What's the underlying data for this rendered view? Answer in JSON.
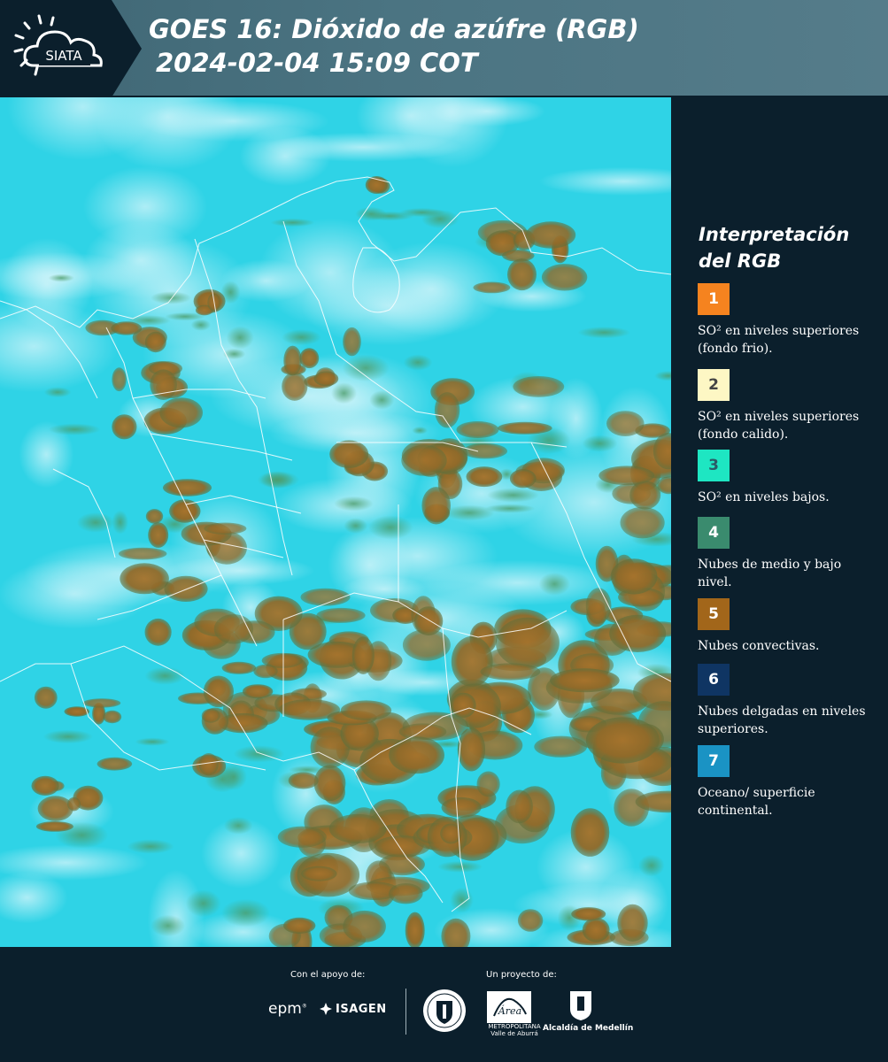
{
  "header": {
    "logo_text": "SIATA",
    "title_line1": "GOES 16: Dióxido de azúfre (RGB)",
    "title_line2": "2024-02-04 15:09 COT"
  },
  "legend": {
    "title_line1": "Interpretación",
    "title_line2": "del RGB",
    "items": [
      {
        "number": "1",
        "color": "#f5831f",
        "num_color": "#ffffff",
        "text": "SO² en niveles superiores (fondo frio)."
      },
      {
        "number": "2",
        "color": "#fdf7c4",
        "num_color": "#444444",
        "text": "SO² en niveles superiores (fondo calido)."
      },
      {
        "number": "3",
        "color": "#1ee6c2",
        "num_color": "#2b5a66",
        "text": "SO² en niveles bajos."
      },
      {
        "number": "4",
        "color": "#3a8b6e",
        "num_color": "#ffffff",
        "text": "Nubes de medio y bajo nivel."
      },
      {
        "number": "5",
        "color": "#a2661a",
        "num_color": "#ffffff",
        "text": "Nubes convectivas."
      },
      {
        "number": "6",
        "color": "#0f3563",
        "num_color": "#ffffff",
        "text": "Nubes delgadas en niveles superiores."
      },
      {
        "number": "7",
        "color": "#1a93c4",
        "num_color": "#ffffff",
        "text": "Oceano/ superficie continental."
      }
    ]
  },
  "map": {
    "background_color": "#2fd3e6",
    "cloud_color": "#9a6b28",
    "border_color": "#ffffff"
  },
  "footer": {
    "support_label": "Con el apoyo de:",
    "project_label": "Un proyecto de:",
    "epm": "epm",
    "isagen": "ISAGEN",
    "area_line1": "METROPOLITANA",
    "area_line2": "Valle de Aburrá",
    "alcaldia": "Alcaldía de Medellín"
  }
}
